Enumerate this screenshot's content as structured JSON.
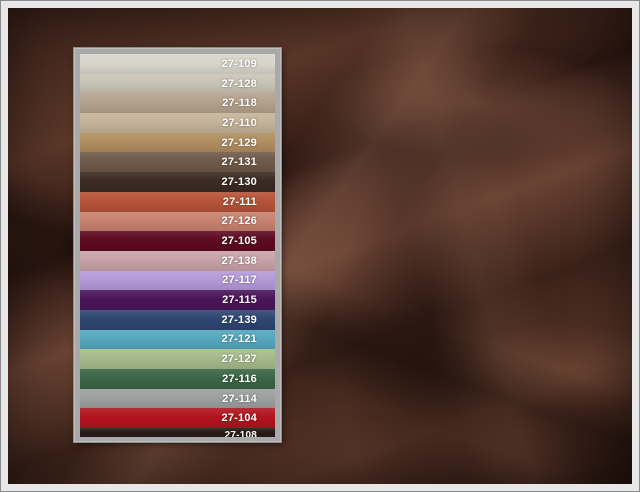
{
  "fabric": {
    "color": "#4a2b20"
  },
  "swatches": [
    {
      "code": "27-109",
      "color": "#d8d6cb"
    },
    {
      "code": "27-128",
      "color": "#c9c4b5"
    },
    {
      "code": "27-118",
      "color": "#b3a28d"
    },
    {
      "code": "27-110",
      "color": "#c5b39a"
    },
    {
      "code": "27-129",
      "color": "#b08e60"
    },
    {
      "code": "27-131",
      "color": "#6f5a48"
    },
    {
      "code": "27-130",
      "color": "#3b2a22"
    },
    {
      "code": "27-111",
      "color": "#b55338"
    },
    {
      "code": "27-126",
      "color": "#c7826f"
    },
    {
      "code": "27-105",
      "color": "#5e0a1f"
    },
    {
      "code": "27-138",
      "color": "#c7a2a9"
    },
    {
      "code": "27-117",
      "color": "#b49ad8"
    },
    {
      "code": "27-115",
      "color": "#4a1559"
    },
    {
      "code": "27-139",
      "color": "#2e4672"
    },
    {
      "code": "27-121",
      "color": "#55a7bd"
    },
    {
      "code": "27-127",
      "color": "#a6bb8c"
    },
    {
      "code": "27-116",
      "color": "#3c6547"
    },
    {
      "code": "27-114",
      "color": "#9da0a0"
    },
    {
      "code": "27-104",
      "color": "#b2141e"
    },
    {
      "code": "27-108",
      "color": "#2a1a18"
    }
  ]
}
